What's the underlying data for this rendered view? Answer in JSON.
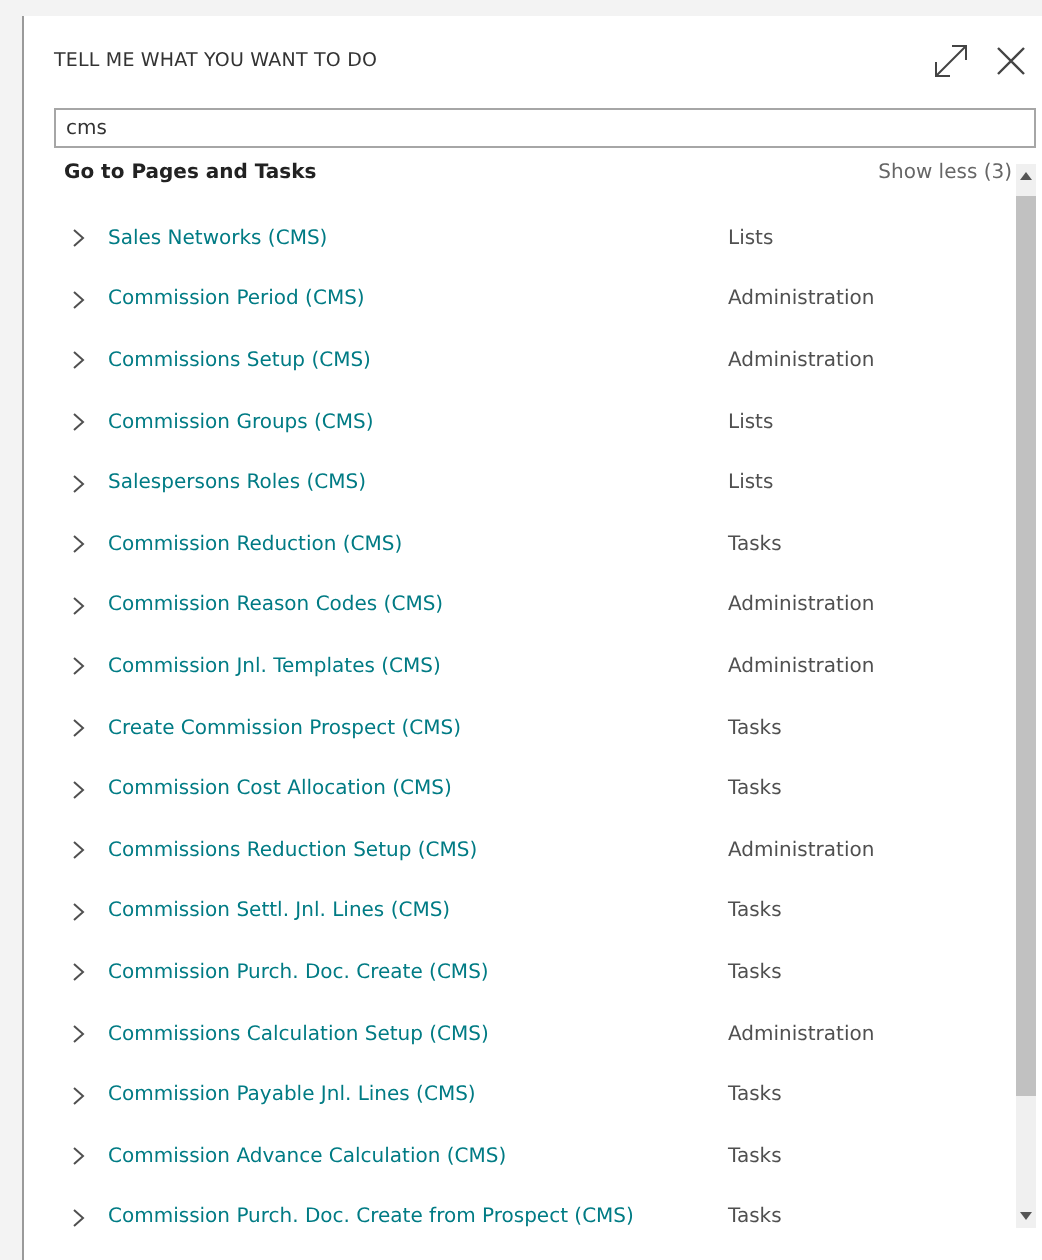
{
  "dialog": {
    "title": "TELL ME WHAT YOU WANT TO DO"
  },
  "search": {
    "value": "cms"
  },
  "section": {
    "title": "Go to Pages and Tasks",
    "toggle": "Show less (3)"
  },
  "results": [
    {
      "name": "Sales Networks (CMS)",
      "category": "Lists"
    },
    {
      "name": "Commission Period (CMS)",
      "category": "Administration"
    },
    {
      "name": "Commissions Setup (CMS)",
      "category": "Administration"
    },
    {
      "name": "Commission Groups (CMS)",
      "category": "Lists"
    },
    {
      "name": "Salespersons Roles (CMS)",
      "category": "Lists"
    },
    {
      "name": "Commission Reduction (CMS)",
      "category": "Tasks"
    },
    {
      "name": "Commission Reason Codes (CMS)",
      "category": "Administration"
    },
    {
      "name": "Commission Jnl. Templates (CMS)",
      "category": "Administration"
    },
    {
      "name": "Create Commission Prospect (CMS)",
      "category": "Tasks"
    },
    {
      "name": "Commission Cost Allocation (CMS)",
      "category": "Tasks"
    },
    {
      "name": "Commissions Reduction Setup (CMS)",
      "category": "Administration"
    },
    {
      "name": "Commission Settl. Jnl. Lines (CMS)",
      "category": "Tasks"
    },
    {
      "name": "Commission Purch. Doc. Create (CMS)",
      "category": "Tasks"
    },
    {
      "name": "Commissions Calculation Setup (CMS)",
      "category": "Administration"
    },
    {
      "name": "Commission Payable Jnl. Lines (CMS)",
      "category": "Tasks"
    },
    {
      "name": "Commission Advance Calculation (CMS)",
      "category": "Tasks"
    },
    {
      "name": "Commission Purch. Doc. Create from Prospect (CMS)",
      "category": "Tasks"
    }
  ]
}
